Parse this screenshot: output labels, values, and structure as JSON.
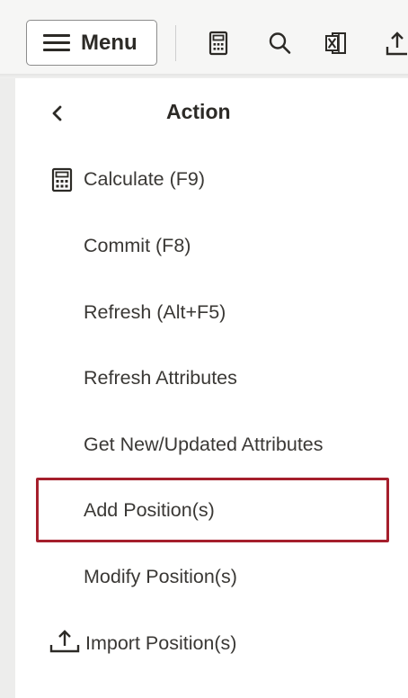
{
  "toolbar": {
    "menu_label": "Menu",
    "icons": [
      "calculator-icon",
      "search-icon",
      "excel-icon",
      "upload-icon"
    ]
  },
  "panel": {
    "title": "Action",
    "items": [
      {
        "label": "Calculate (F9)",
        "icon": "calculator-icon"
      },
      {
        "label": "Commit (F8)"
      },
      {
        "label": "Refresh (Alt+F5)"
      },
      {
        "label": "Refresh Attributes"
      },
      {
        "label": "Get New/Updated Attributes"
      },
      {
        "label": "Add Position(s)",
        "highlighted": true
      },
      {
        "label": "Modify Position(s)"
      },
      {
        "label": "Import Position(s)",
        "icon": "upload-icon"
      }
    ]
  },
  "colors": {
    "highlight_border": "#a51f2c",
    "text": "#3a3835",
    "background": "#f1f1f0"
  }
}
